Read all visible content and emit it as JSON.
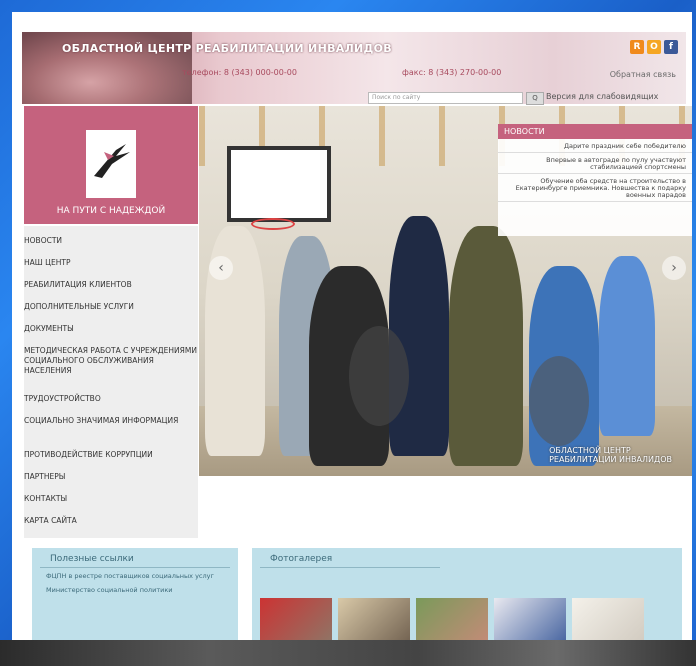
{
  "banner": {
    "title": "ОБЛАСТНОЙ ЦЕНТР РЕАБИЛИТАЦИИ ИНВАЛИДОВ",
    "phone": "телефон: 8 (343) 000-00-00",
    "fax": "факс: 8 (343) 270-00-00",
    "feedback": "Обратная связь"
  },
  "social": {
    "rss": "R",
    "ok": "O",
    "fb": "f"
  },
  "search": {
    "placeholder": "Поиск по сайту",
    "button": "Q",
    "accessible": "Версия для слабовидящих"
  },
  "logo": {
    "caption": "НА ПУТИ С НАДЕЖДОЙ"
  },
  "menu": {
    "items": [
      "НОВОСТИ",
      "НАШ ЦЕНТР",
      "РЕАБИЛИТАЦИЯ КЛИЕНТОВ",
      "ДОПОЛНИТЕЛЬНЫЕ УСЛУГИ",
      "ДОКУМЕНТЫ",
      "МЕТОДИЧЕСКАЯ РАБОТА С УЧРЕЖДЕНИЯМИ СОЦИАЛЬНОГО ОБСЛУЖИВАНИЯ НАСЕЛЕНИЯ",
      "ТРУДОУСТРОЙСТВО",
      "СОЦИАЛЬНО ЗНАЧИМАЯ ИНФОРМАЦИЯ",
      "ПРОТИВОДЕЙСТВИЕ КОРРУПЦИИ",
      "ПАРТНЕРЫ",
      "КОНТАКТЫ",
      "КАРТА САЙТА"
    ]
  },
  "news": {
    "header": "НОВОСТИ",
    "items": [
      "Дарите праздник себе победителю",
      "Впервые в автограде по пулу участвуют стабилизацией спортсмены",
      "Обучение оба средств на строительство в Екатеринбурге приемника. Новшества к подарку военных парадов"
    ]
  },
  "slider": {
    "watermark_line1": "ОБЛАСТНОЙ ЦЕНТР",
    "watermark_line2": "РЕАБИЛИТАЦИИ ИНВАЛИДОВ",
    "prev": "‹",
    "next": "›"
  },
  "useful_links": {
    "title": "Полезные ссылки",
    "items": [
      "ФЦПН в реестре поставщиков социальных услуг",
      "Министерство социальной политики"
    ]
  },
  "gallery": {
    "title": "Фотогалерея"
  }
}
